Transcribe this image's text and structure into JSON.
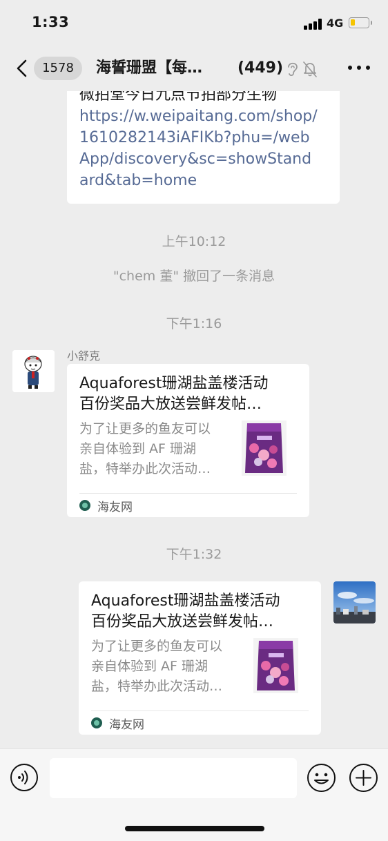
{
  "status_bar": {
    "time": "1:33",
    "network": "4G",
    "battery_level": 0.25,
    "battery_color": "#f5c400"
  },
  "nav": {
    "back_count": "1578",
    "title": "海誓珊盟【每…",
    "member_count": "(449)",
    "icons": [
      "back-chevron-icon",
      "ear-icon",
      "mute-bell-icon",
      "more-icon"
    ]
  },
  "messages": {
    "top_bubble": {
      "partial_line": "微拍堂今日九点节拍部分生物",
      "link_lines": [
        "https://w.weipaitang.com/shop/",
        "1610282143iAFIKb?phu=/web",
        "App/discovery&sc=showStand",
        "ard&tab=home"
      ]
    },
    "time_1": "上午10:12",
    "recall_notice": "\"chem 董\" 撤回了一条消息",
    "time_2": "下午1:16",
    "sender_name": "小舒克",
    "card_left": {
      "title_lines": [
        "Aquaforest珊湖盐盖楼活动",
        "百份奖品大放送尝鲜发帖…"
      ],
      "desc_lines": [
        "为了让更多的鱼友可以",
        "亲自体验到 AF 珊湖",
        "盐，特举办此次活动…"
      ],
      "source": "海友网"
    },
    "time_3": "下午1:32",
    "card_right": {
      "title_lines": [
        "Aquaforest珊湖盐盖楼活动",
        "百份奖品大放送尝鲜发帖…"
      ],
      "desc_lines": [
        "为了让更多的鱼友可以",
        "亲自体验到 AF 珊湖",
        "盐，特举办此次活动…"
      ],
      "source": "海友网"
    }
  },
  "input_bar": {
    "placeholder": ""
  },
  "colors": {
    "background": "#ededed",
    "link": "#576b95",
    "bubble": "#ffffff",
    "meta_text": "#9a9a9a"
  }
}
